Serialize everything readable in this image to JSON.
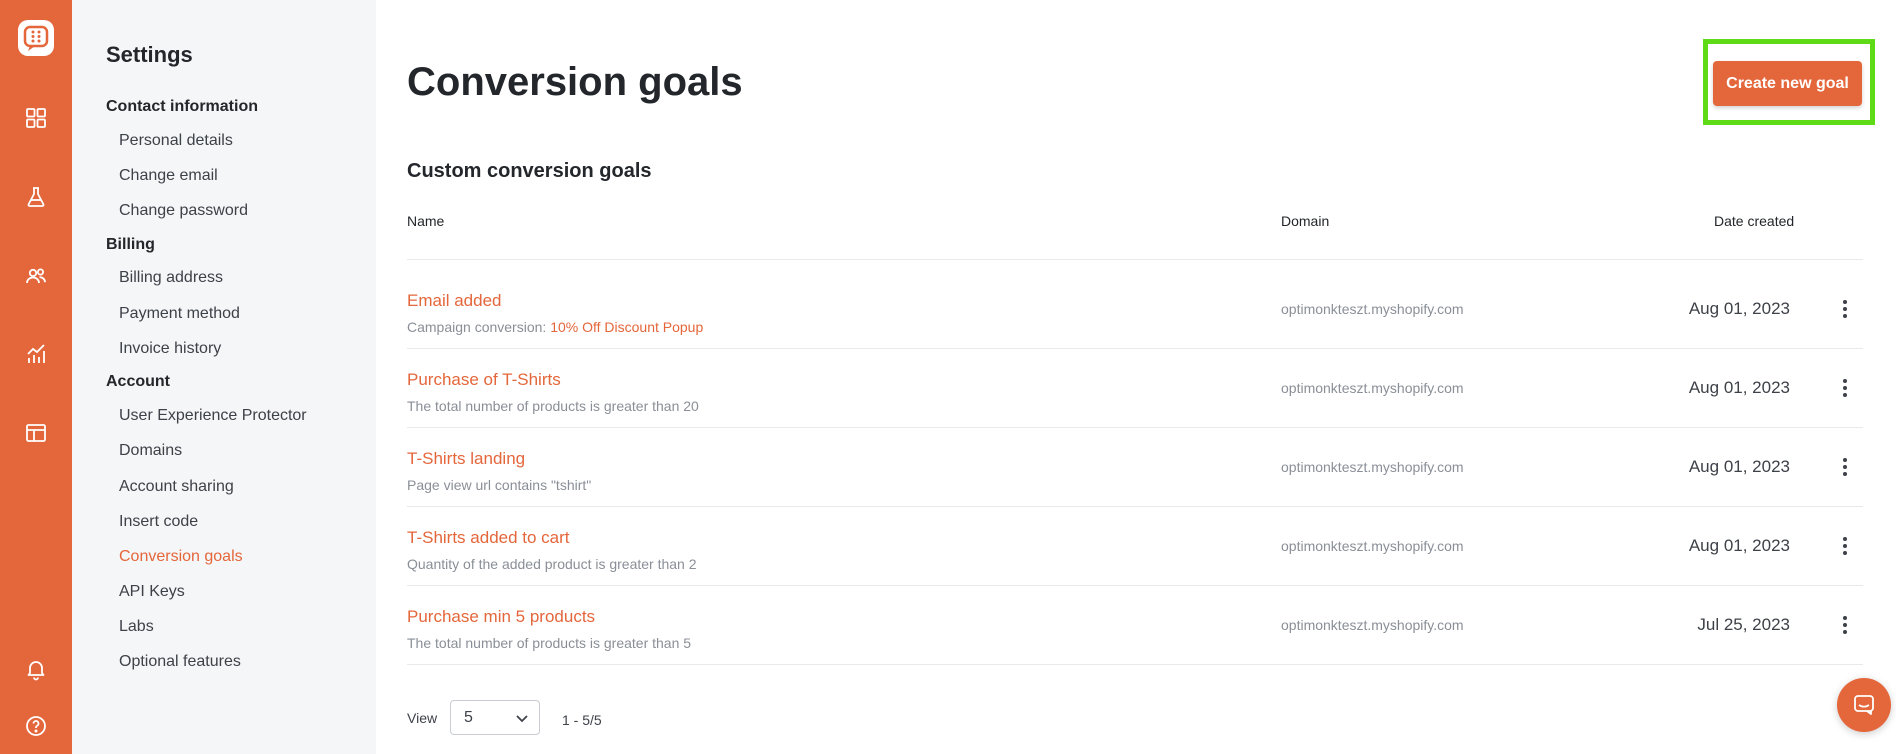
{
  "colors": {
    "brand": "#e4663b",
    "highlight": "#5edb16"
  },
  "rail": {
    "icons": [
      "logo-icon",
      "dashboard-icon",
      "flask-icon",
      "users-icon",
      "analytics-icon",
      "templates-icon",
      "bell-icon",
      "help-icon"
    ]
  },
  "sidebar": {
    "title": "Settings",
    "groups": [
      {
        "label": "Contact information",
        "items": [
          "Personal details",
          "Change email",
          "Change password"
        ]
      },
      {
        "label": "Billing",
        "items": [
          "Billing address",
          "Payment method",
          "Invoice history"
        ]
      },
      {
        "label": "Account",
        "items": [
          "User Experience Protector",
          "Domains",
          "Account sharing",
          "Insert code",
          "Conversion goals",
          "API Keys",
          "Labs",
          "Optional features"
        ]
      }
    ],
    "active_item": "Conversion goals"
  },
  "main": {
    "title": "Conversion goals",
    "create_button": "Create new goal",
    "section_title": "Custom conversion goals",
    "columns": {
      "name": "Name",
      "domain": "Domain",
      "date": "Date created"
    },
    "rows": [
      {
        "name": "Email added",
        "desc_prefix": "Campaign conversion: ",
        "desc_highlight": "10% Off Discount Popup",
        "domain": "optimonkteszt.myshopify.com",
        "date": "Aug 01, 2023"
      },
      {
        "name": "Purchase of T-Shirts",
        "desc_prefix": "The total number of products is greater than 20",
        "desc_highlight": "",
        "domain": "optimonkteszt.myshopify.com",
        "date": "Aug 01, 2023"
      },
      {
        "name": "T-Shirts landing",
        "desc_prefix": "Page view url contains \"tshirt\"",
        "desc_highlight": "",
        "domain": "optimonkteszt.myshopify.com",
        "date": "Aug 01, 2023"
      },
      {
        "name": "T-Shirts added to cart",
        "desc_prefix": "Quantity of the added product is greater than 2",
        "desc_highlight": "",
        "domain": "optimonkteszt.myshopify.com",
        "date": "Aug 01, 2023"
      },
      {
        "name": "Purchase min 5 products",
        "desc_prefix": "The total number of products is greater than 5",
        "desc_highlight": "",
        "domain": "optimonkteszt.myshopify.com",
        "date": "Jul 25, 2023"
      }
    ],
    "pagination": {
      "view_label": "View",
      "page_size": "5",
      "range": "1 - 5/5"
    }
  }
}
